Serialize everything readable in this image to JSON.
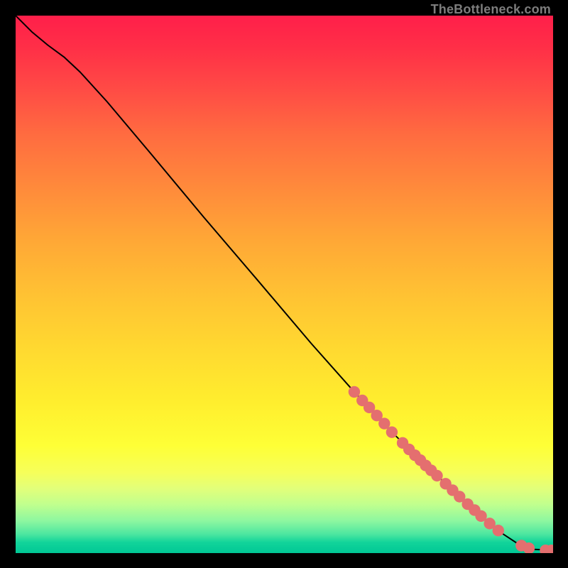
{
  "attribution": "TheBottleneck.com",
  "chart_data": {
    "type": "line",
    "title": "",
    "xlabel": "",
    "ylabel": "",
    "xlim": [
      0,
      100
    ],
    "ylim": [
      0,
      100
    ],
    "grid": false,
    "legend": false,
    "curve_points": [
      {
        "x": 0.0,
        "y": 100.0
      },
      {
        "x": 3.0,
        "y": 97.0
      },
      {
        "x": 6.0,
        "y": 94.5
      },
      {
        "x": 9.0,
        "y": 92.3
      },
      {
        "x": 12.0,
        "y": 89.5
      },
      {
        "x": 17.0,
        "y": 84.0
      },
      {
        "x": 25.0,
        "y": 74.5
      },
      {
        "x": 35.0,
        "y": 62.5
      },
      {
        "x": 45.0,
        "y": 50.8
      },
      {
        "x": 55.0,
        "y": 39.0
      },
      {
        "x": 63.0,
        "y": 30.0
      },
      {
        "x": 70.0,
        "y": 22.5
      },
      {
        "x": 78.0,
        "y": 14.8
      },
      {
        "x": 85.0,
        "y": 8.3
      },
      {
        "x": 90.0,
        "y": 4.0
      },
      {
        "x": 93.5,
        "y": 1.7
      },
      {
        "x": 96.5,
        "y": 0.7
      },
      {
        "x": 100.0,
        "y": 0.5
      }
    ],
    "highlighted_points": [
      {
        "x": 63.0,
        "y": 30.0
      },
      {
        "x": 64.5,
        "y": 28.4
      },
      {
        "x": 65.8,
        "y": 27.1
      },
      {
        "x": 67.2,
        "y": 25.6
      },
      {
        "x": 68.6,
        "y": 24.1
      },
      {
        "x": 70.0,
        "y": 22.5
      },
      {
        "x": 72.0,
        "y": 20.5
      },
      {
        "x": 73.2,
        "y": 19.3
      },
      {
        "x": 74.3,
        "y": 18.2
      },
      {
        "x": 75.3,
        "y": 17.3
      },
      {
        "x": 76.3,
        "y": 16.3
      },
      {
        "x": 77.3,
        "y": 15.4
      },
      {
        "x": 78.4,
        "y": 14.4
      },
      {
        "x": 80.0,
        "y": 12.9
      },
      {
        "x": 81.3,
        "y": 11.7
      },
      {
        "x": 82.6,
        "y": 10.5
      },
      {
        "x": 84.1,
        "y": 9.1
      },
      {
        "x": 85.4,
        "y": 8.0
      },
      {
        "x": 86.6,
        "y": 6.9
      },
      {
        "x": 88.2,
        "y": 5.5
      },
      {
        "x": 89.8,
        "y": 4.2
      },
      {
        "x": 94.1,
        "y": 1.4
      },
      {
        "x": 95.5,
        "y": 0.9
      },
      {
        "x": 98.6,
        "y": 0.5
      },
      {
        "x": 99.7,
        "y": 0.5
      }
    ],
    "colors": {
      "curve_stroke": "#000000",
      "point_fill": "#e46f6f",
      "point_stroke": "#c94f4f"
    }
  }
}
